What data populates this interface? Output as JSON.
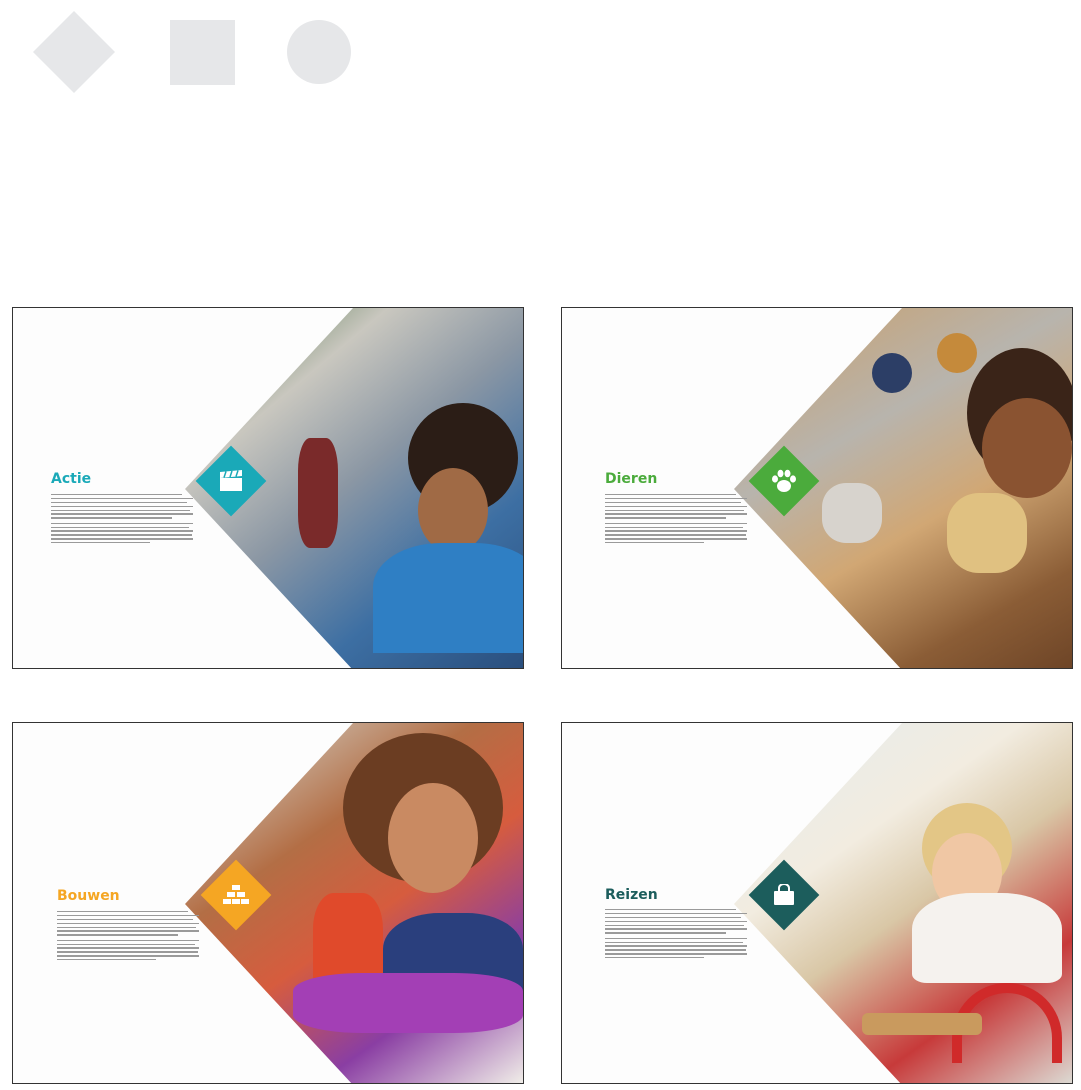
{
  "header_shapes": [
    "diamond",
    "square",
    "circle"
  ],
  "cards": [
    {
      "title": "Actie",
      "accent": "#1aa9b8",
      "icon": "clapperboard-icon",
      "body": "Lorem ipsum dolor sit amet, consectetur adipiscing elit."
    },
    {
      "title": "Dieren",
      "accent": "#4bab3c",
      "icon": "paw-icon",
      "body": "Lorem ipsum dolor sit amet, consectetur adipiscing elit."
    },
    {
      "title": "Bouwen",
      "accent": "#f5a623",
      "icon": "bricks-icon",
      "body": "Lorem ipsum dolor sit amet, consectetur adipiscing elit."
    },
    {
      "title": "Reizen",
      "accent": "#1c5d5c",
      "icon": "bag-icon",
      "body": "Lorem ipsum dolor sit amet, consectetur adipiscing elit."
    }
  ]
}
